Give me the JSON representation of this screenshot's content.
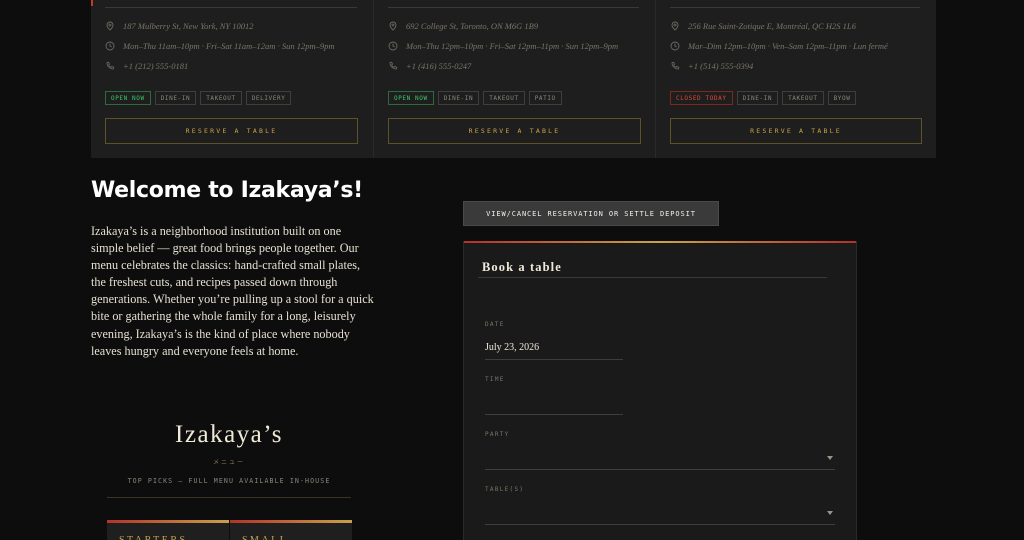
{
  "locations": [
    {
      "address": "187 Mulberry St, New York, NY 10012",
      "hours": "Mon–Thu 11am–10pm · Fri–Sat 11am–12am · Sun 12pm–9pm",
      "phone": "+1 (212) 555-0181",
      "status": "OPEN NOW",
      "services": [
        "DINE-IN",
        "TAKEOUT",
        "DELIVERY"
      ],
      "reserve_label": "RESERVE A TABLE"
    },
    {
      "address": "692 College St, Toronto, ON M6G 1B9",
      "hours": "Mon–Thu 12pm–10pm · Fri–Sat 12pm–11pm · Sun 12pm–9pm",
      "phone": "+1 (416) 555-0247",
      "status": "OPEN NOW",
      "services": [
        "DINE-IN",
        "TAKEOUT",
        "PATIO"
      ],
      "reserve_label": "RESERVE A TABLE"
    },
    {
      "address": "256 Rue Saint-Zotique E, Montréal, QC H2S 1L6",
      "hours": "Mar–Dim 12pm–10pm · Ven–Sam 12pm–11pm · Lun fermé",
      "phone": "+1 (514) 555-0394",
      "status": "CLOSED TODAY",
      "services": [
        "DINE-IN",
        "TAKEOUT",
        "BYOW"
      ],
      "reserve_label": "RESERVE A TABLE"
    }
  ],
  "icons": {
    "pin": "map-pin-icon",
    "clock": "clock-icon",
    "phone": "phone-icon"
  },
  "colors": {
    "open": "#3fc46a",
    "closed": "#e0463a",
    "gold": "#c9a24a",
    "accent_red": "#b3322a"
  },
  "welcome": {
    "title": "Welcome to Izakaya’s!",
    "body": "Izakaya’s is a neighborhood institution built on one simple belief — great food brings people together. Our menu celebrates the classics: hand-crafted small plates, the freshest cuts, and recipes passed down through generations. Whether you’re pulling up a stool for a quick bite or gathering the whole family for a long, leisurely evening, Izakaya’s is the kind of place where nobody leaves hungry and everyone feels at home."
  },
  "menu": {
    "logo": "Izakaya’s",
    "sub": "メニュー",
    "tagline": "TOP PICKS — FULL MENU AVAILABLE IN-HOUSE",
    "tabs": [
      "STARTERS",
      "SMALL"
    ]
  },
  "booking": {
    "view_cancel_label": "VIEW/CANCEL RESERVATION OR SETTLE DEPOSIT",
    "title": "Book a table",
    "date_label": "DATE",
    "date_value": "July 23, 2026",
    "time_label": "TIME",
    "time_value": "",
    "party_label": "PARTY",
    "party_value": "",
    "tables_label": "TABLE(S)",
    "tables_value": ""
  }
}
